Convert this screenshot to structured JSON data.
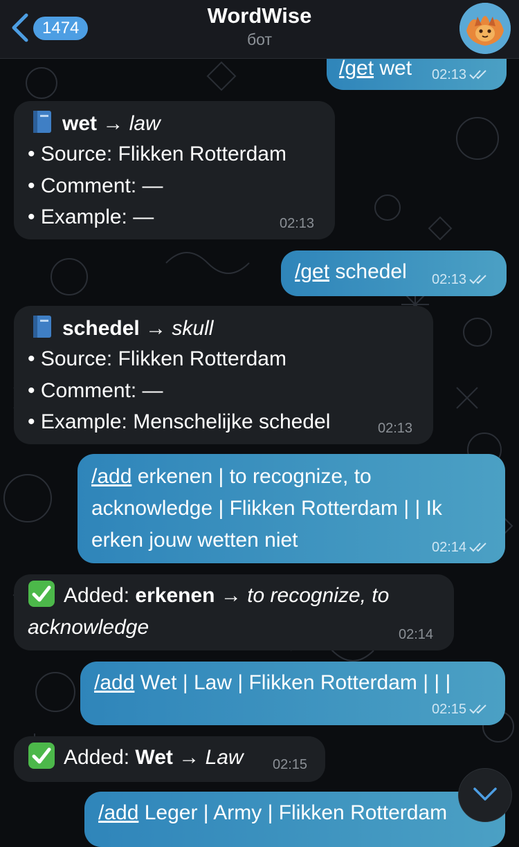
{
  "header": {
    "back_count": "1474",
    "title": "WordWise",
    "subtitle": "бот"
  },
  "messages": [
    {
      "kind": "out",
      "cmd": "/get",
      "text": " wet",
      "time": "02:13"
    },
    {
      "kind": "in",
      "word": "wet",
      "translation": "law",
      "lines": [
        "• Source: Flikken Rotterdam",
        "• Comment: —",
        "• Example: —"
      ],
      "time": "02:13"
    },
    {
      "kind": "out",
      "cmd": "/get",
      "text": " schedel",
      "time": "02:13"
    },
    {
      "kind": "in",
      "word": "schedel",
      "translation": "skull",
      "lines": [
        "• Source: Flikken Rotterdam",
        "• Comment: —",
        "• Example: Menschelijke schedel"
      ],
      "time": "02:13"
    },
    {
      "kind": "out",
      "cmd": "/add",
      "text": " erkenen | to recognize, to acknowledge | Flikken Rotterdam | | Ik erken jouw wetten niet",
      "time": "02:14"
    },
    {
      "kind": "in",
      "prefix": "Added: ",
      "word": "erkenen",
      "translation": "to recognize, to acknowledge",
      "time": "02:14"
    },
    {
      "kind": "out",
      "cmd": "/add",
      "text": " Wet | Law | Flikken Rotterdam | | |",
      "time": "02:15"
    },
    {
      "kind": "in",
      "prefix": "Added: ",
      "word": "Wet",
      "translation": "Law",
      "time": "02:15"
    },
    {
      "kind": "out",
      "cmd": "/add",
      "text": " Leger | Army | Flikken Rotterdam",
      "time": ""
    }
  ],
  "arrow": "→",
  "icons": {
    "book": "blue-book-icon",
    "check": "check-mark-icon",
    "read_ticks": "double-check-icon",
    "scroll": "chevron-down-icon"
  },
  "colors": {
    "accent": "#4d9ee3",
    "outgoing_bubble": "#2f85ba",
    "incoming_bubble": "#1d2024",
    "background": "#0b0d10"
  }
}
